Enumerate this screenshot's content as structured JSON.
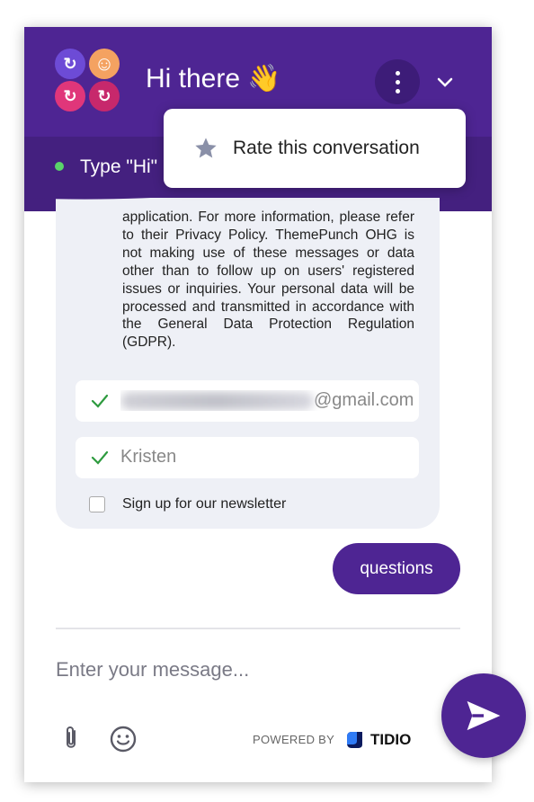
{
  "header": {
    "greeting": "Hi there",
    "greeting_emoji": "👋",
    "status_text": "Type \"Hi\"",
    "accent_color": "#4e2593",
    "status_color": "#5ad36a"
  },
  "menu": {
    "items": [
      {
        "label": "Rate this conversation",
        "icon": "star-icon"
      }
    ]
  },
  "chat": {
    "policy_text": "application. For more information, please refer to their Privacy Policy. ThemePunch OHG is not making use of these messages or data other than to follow up on users' registered issues or inquiries. Your personal data will be processed and transmitted in accordance with the General Data Protection Regulation (GDPR).",
    "email_visible_suffix": "@gmail.com",
    "name_value": "Kristen",
    "newsletter_label": "Sign up for our newsletter",
    "user_bubble": "questions"
  },
  "composer": {
    "placeholder": "Enter your message...",
    "powered_by": "POWERED BY",
    "brand": "TIDIO"
  }
}
